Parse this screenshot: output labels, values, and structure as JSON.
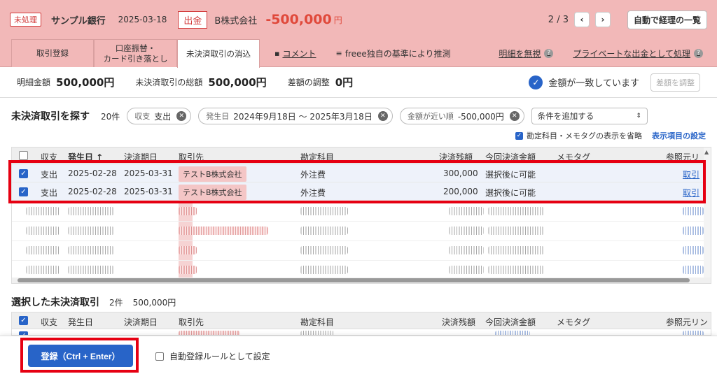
{
  "header": {
    "status_badge": "未処理",
    "bank_name": "サンプル銀行",
    "date": "2025-03-18",
    "io_type": "出金",
    "partner": "B株式会社",
    "amount": "-500,000",
    "currency": "円",
    "pager": "2 / 3",
    "prev": "‹",
    "next": "›",
    "list_button": "自動で経理の一覧"
  },
  "tabs": [
    {
      "label": "取引登録"
    },
    {
      "label": "口座振替・\nカード引き落とし"
    },
    {
      "label": "未決済取引の消込"
    }
  ],
  "tab_links": {
    "comment": "コメント",
    "freee_guess": "freee独自の基準により推測",
    "ignore": "明細を無視",
    "private": "プライベートな出金として処理"
  },
  "summary": {
    "detail_label": "明細金額",
    "detail_value": "500,000円",
    "total_label": "未決済取引の総額",
    "total_value": "500,000円",
    "diff_label": "差額の調整",
    "diff_value": "0円",
    "match_text": "金額が一致しています",
    "adjust_button": "差額を調整"
  },
  "search": {
    "title": "未決済取引を探す",
    "count": "20件",
    "chips": [
      {
        "key": "収支",
        "value": "支出"
      },
      {
        "key": "発生日",
        "value": "2024年9月18日 〜 2025年3月18日"
      },
      {
        "key": "金額が近い順",
        "value": "-500,000円"
      }
    ],
    "add_condition": "条件を追加する",
    "omit_option": "勘定科目・メモタグの表示を省略",
    "display_settings": "表示項目の設定"
  },
  "table": {
    "headers": [
      "収支",
      "発生日 ↑",
      "決済期日",
      "取引先",
      "勘定科目",
      "決済残額",
      "今回決済金額",
      "メモタグ",
      "参照元リ"
    ],
    "rows": [
      {
        "io": "支出",
        "date": "2025-02-28",
        "due": "2025-03-31",
        "partner": "テストB株式会社",
        "account": "外注費",
        "remaining": "300,000",
        "settle": "選択後に可能",
        "memo": "",
        "ref": "取引"
      },
      {
        "io": "支出",
        "date": "2025-02-28",
        "due": "2025-03-31",
        "partner": "テストB株式会社",
        "account": "外注費",
        "remaining": "200,000",
        "settle": "選択後に可能",
        "memo": "",
        "ref": "取引"
      }
    ]
  },
  "selected": {
    "title": "選択した未決済取引",
    "count": "2件",
    "sum": "500,000円",
    "headers": [
      "収支",
      "発生日",
      "決済期日",
      "取引先",
      "勘定科目",
      "決済残額",
      "今回決済金額",
      "メモタグ",
      "参照元リン"
    ]
  },
  "footer": {
    "register_button": "登録（Ctrl + Enter）",
    "auto_rule": "自動登録ルールとして設定"
  },
  "colors": {
    "header_bg": "#f2b8b8",
    "accent_blue": "#2864c8",
    "amount_red": "#e0493b",
    "highlight_red": "#e60012"
  }
}
